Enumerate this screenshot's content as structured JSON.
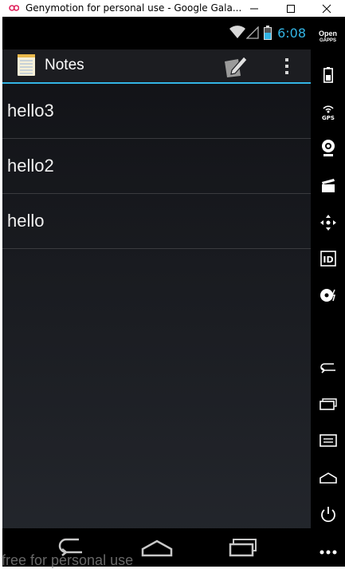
{
  "window": {
    "title": "Genymotion for personal use - Google Gala..."
  },
  "statusbar": {
    "time": "6:08",
    "time_color": "#33b5e5"
  },
  "actionbar": {
    "title": "Notes",
    "accent_color": "#33b5e5",
    "icons": [
      "notepad-app-icon",
      "new-note-icon",
      "overflow-menu-icon"
    ]
  },
  "notes": [
    {
      "title": "hello3"
    },
    {
      "title": "hello2"
    },
    {
      "title": "hello"
    }
  ],
  "navbar": {
    "icons": [
      "back-icon",
      "home-icon",
      "recent-apps-icon"
    ]
  },
  "watermark": "free for personal use",
  "sidebar": {
    "opengapps_line1": "Open",
    "opengapps_line2": "GAPPS",
    "gps_label": "GPS",
    "id_label": "ID",
    "icons": [
      "opengapps-icon",
      "battery-widget-icon",
      "gps-icon",
      "webcam-icon",
      "media-clapper-icon",
      "dpad-move-icon",
      "device-id-icon",
      "disk-capture-icon",
      "back-icon",
      "recent-apps-icon",
      "menu-icon",
      "home-icon",
      "power-icon",
      "more-icon"
    ]
  }
}
